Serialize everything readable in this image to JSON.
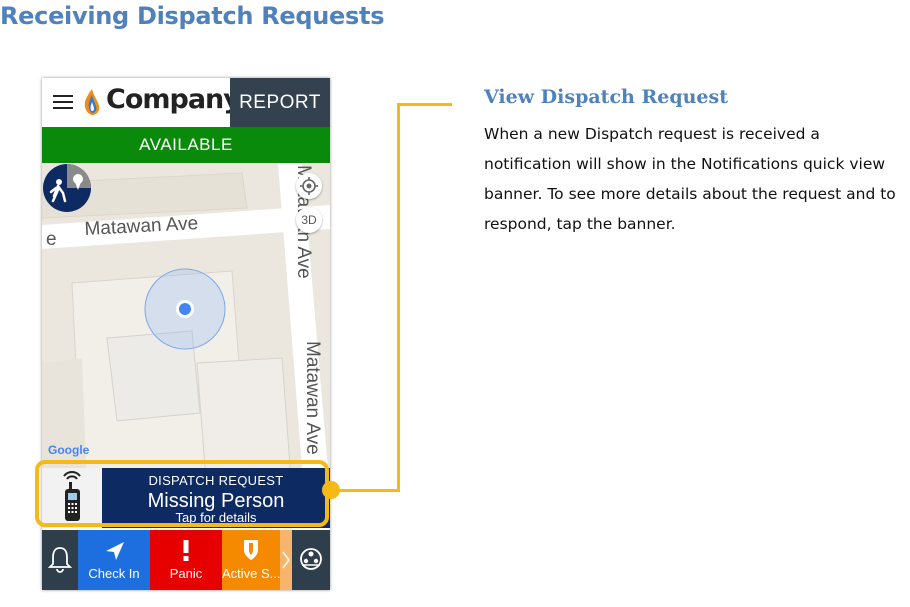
{
  "page": {
    "title": "Receiving Dispatch Requests"
  },
  "app": {
    "logo_text": "Company",
    "report_label": "REPORT",
    "status_label": "AVAILABLE"
  },
  "map": {
    "streets": [
      "Matawan Ave",
      "Matawan Ave",
      "Matawan Ave",
      "e"
    ],
    "btn_3d": "3D",
    "google_label": "Google"
  },
  "dispatch": {
    "label": "DISPATCH REQUEST",
    "title": "Missing Person",
    "subtitle": "Tap for details"
  },
  "nav": {
    "items": [
      {
        "label": "Check In",
        "icon": "navigation-arrow-icon"
      },
      {
        "label": "Panic",
        "icon": "exclamation-icon"
      },
      {
        "label": "Active S...",
        "icon": "shield-icon"
      }
    ]
  },
  "side": {
    "heading": "View Dispatch Request",
    "body": "When a new Dispatch request is received a notification will show in the Notifications quick view banner. To see more details about the request and to respond, tap the banner."
  },
  "colors": {
    "accent": "#4f81bd",
    "callout": "#f6b915",
    "status_green": "#0a8a0a",
    "dispatch_navy": "#0e2a63",
    "panic_red": "#e60000",
    "checkin_blue": "#1d6fe0",
    "active_orange": "#f58a00"
  }
}
